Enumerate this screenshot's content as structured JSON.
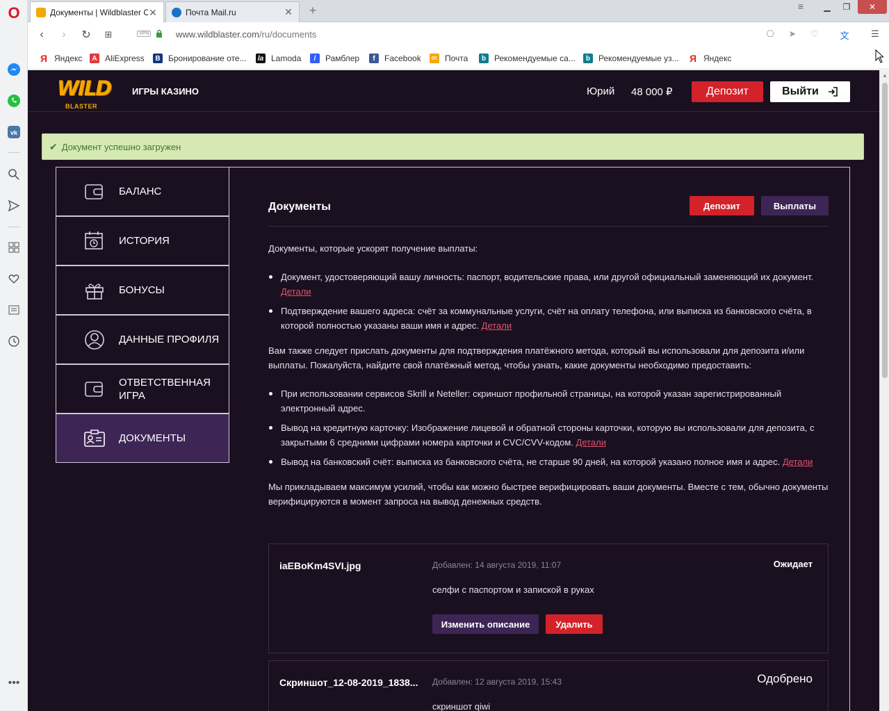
{
  "browser": {
    "tabs": [
      {
        "title": "Документы | Wildblaster C",
        "active": true
      },
      {
        "title": "Почта Mail.ru",
        "active": false
      }
    ],
    "url_domain": "www.wildblaster.com",
    "url_path": "/ru/documents",
    "vpn_label": "VPN",
    "bookmarks": [
      {
        "label": "Яндекс",
        "icon": "yandex-icon"
      },
      {
        "label": "AliExpress",
        "icon": "aliexpress-icon"
      },
      {
        "label": "Бронирование оте...",
        "icon": "booking-icon"
      },
      {
        "label": "Lamoda",
        "icon": "lamoda-icon"
      },
      {
        "label": "Рамблер",
        "icon": "rambler-icon"
      },
      {
        "label": "Facebook",
        "icon": "facebook-icon"
      },
      {
        "label": "Почта",
        "icon": "mail-icon"
      },
      {
        "label": "Рекомендуемые са...",
        "icon": "bing-icon"
      },
      {
        "label": "Рекомендуемые уз...",
        "icon": "bing-icon"
      },
      {
        "label": "Яндекс",
        "icon": "yandex-icon"
      }
    ]
  },
  "site": {
    "logo_top": "WILD",
    "logo_bottom": "BLASTER",
    "nav_games": "ИГРЫ КАЗИНО",
    "user_name": "Юрий",
    "balance": "48 000 ₽",
    "deposit_label": "Депозит",
    "logout_label": "Выйти"
  },
  "alert": {
    "text": "Документ успешно загружен"
  },
  "menu": [
    {
      "label": "БАЛАНС",
      "icon": "wallet-icon"
    },
    {
      "label": "ИСТОРИЯ",
      "icon": "calendar-clock-icon"
    },
    {
      "label": "БОНУСЫ",
      "icon": "gift-icon"
    },
    {
      "label": "ДАННЫЕ ПРОФИЛЯ",
      "icon": "user-circle-icon"
    },
    {
      "label": "ОТВЕТСТВЕННАЯ ИГРА",
      "icon": "wallet-icon"
    },
    {
      "label": "ДОКУМЕНТЫ",
      "icon": "id-card-icon"
    }
  ],
  "documents": {
    "title": "Документы",
    "btn_deposit": "Депозит",
    "btn_payouts": "Выплаты",
    "intro": "Документы, которые ускорят получение выплаты:",
    "bullets1": [
      {
        "text": "Документ, удостоверяющий вашу личность: паспорт, водительские права, или другой официальный заменяющий их документ.",
        "link": "Детали"
      },
      {
        "text": "Подтверждение вашего адреса: счёт за коммунальные услуги, счёт на оплату телефона, или выписка из банковского счёта, в которой полностью указаны ваши имя и адрес.",
        "link": "Детали"
      }
    ],
    "para2": "Вам также следует прислать документы для подтверждения платёжного метода, который вы использовали для депозита и/или выплаты. Пожалуйста, найдите свой платёжный метод, чтобы узнать, какие документы необходимо предоставить:",
    "bullets2": [
      {
        "text": "При использовании сервисов Skrill и Neteller: скриншот профильной страницы, на которой указан зарегистрированный электронный адрес.",
        "link": ""
      },
      {
        "text": "Вывод на кредитную карточку: Изображение лицевой и обратной стороны карточки, которую вы использовали для депозита, с закрытыми 6 средними цифрами номера карточки и CVC/CVV-кодом.",
        "link": "Детали"
      },
      {
        "text": "Вывод на банковский счёт: выписка из банковского счёта, не старше 90 дней, на которой указано полное имя и адрес.",
        "link": "Детали"
      }
    ],
    "para3": "Мы прикладываем максимум усилий, чтобы как можно быстрее верифицировать ваши документы. Вместе с тем, обычно документы верифицируются в момент запроса на вывод денежных средств.",
    "files": [
      {
        "name": "iaEBoKm4SVI.jpg",
        "added": "Добавлен: 14 августа 2019, 11:07",
        "status": "Ожидает",
        "description": "селфи с паспортом и запиской в руках",
        "edit_label": "Изменить описание",
        "delete_label": "Удалить"
      },
      {
        "name": "Скриншот_12-08-2019_1838...",
        "added": "Добавлен: 12 августа 2019, 15:43",
        "status": "Одобрено",
        "description": "скриншот qiwi"
      }
    ]
  },
  "colors": {
    "accent_red": "#d3222a",
    "accent_purple": "#3d2656",
    "page_bg": "#1b1020",
    "success_bg": "#d6e9b4",
    "link": "#e0556a",
    "logo": "#f5a800"
  }
}
